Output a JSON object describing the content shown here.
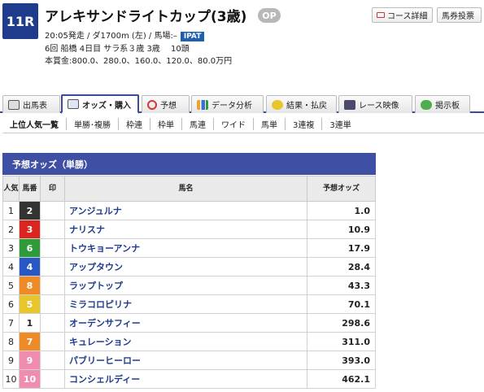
{
  "race": {
    "number": "11R",
    "title": "アレキサンドライトカップ(3歳)",
    "grade": "OP",
    "line1": "20:05発走 / ダ1700m (左) / 馬場:–",
    "ipat": "IPAT",
    "line2": "6回 船橋 4日目 サラ系３歳 3歳　 10頭",
    "line3": "本賞金:800.0、280.0、160.0、120.0、80.0万円"
  },
  "top_buttons": {
    "course": "コース詳細",
    "vote": "馬券投票"
  },
  "tabs": [
    "出馬表",
    "オッズ・購入",
    "予想",
    "データ分析",
    "結果・払戻",
    "レース映像",
    "掲示板"
  ],
  "subtabs": [
    "上位人気一覧",
    "単勝･複勝",
    "枠連",
    "枠単",
    "馬連",
    "ワイド",
    "馬単",
    "3連複",
    "3連単"
  ],
  "odds_section": {
    "title": "予想オッズ（単勝）",
    "headers": {
      "rank": "人気",
      "umaban": "馬番",
      "mark": "印",
      "name": "馬名",
      "odds": "予想オッズ"
    },
    "rows": [
      {
        "rank": "1",
        "umaban": "2",
        "waku": 2,
        "name": "アンジュルナ",
        "odds": "1.0"
      },
      {
        "rank": "2",
        "umaban": "3",
        "waku": 3,
        "name": "ナリスナ",
        "odds": "10.9"
      },
      {
        "rank": "3",
        "umaban": "6",
        "waku": 6,
        "name": "トウキョーアンナ",
        "odds": "17.9"
      },
      {
        "rank": "4",
        "umaban": "4",
        "waku": 4,
        "name": "アップタウン",
        "odds": "28.4"
      },
      {
        "rank": "5",
        "umaban": "8",
        "waku": 7,
        "name": "ラップトップ",
        "odds": "43.3"
      },
      {
        "rank": "6",
        "umaban": "5",
        "waku": 5,
        "name": "ミラコロピリナ",
        "odds": "70.1"
      },
      {
        "rank": "7",
        "umaban": "1",
        "waku": 1,
        "name": "オーデンサフィー",
        "odds": "298.6"
      },
      {
        "rank": "8",
        "umaban": "7",
        "waku": 7,
        "name": "キュレーション",
        "odds": "311.0"
      },
      {
        "rank": "9",
        "umaban": "9",
        "waku": 8,
        "name": "パブリーヒーロー",
        "odds": "393.0"
      },
      {
        "rank": "10",
        "umaban": "10",
        "waku": 8,
        "name": "コンシェルディー",
        "odds": "462.1"
      }
    ]
  }
}
